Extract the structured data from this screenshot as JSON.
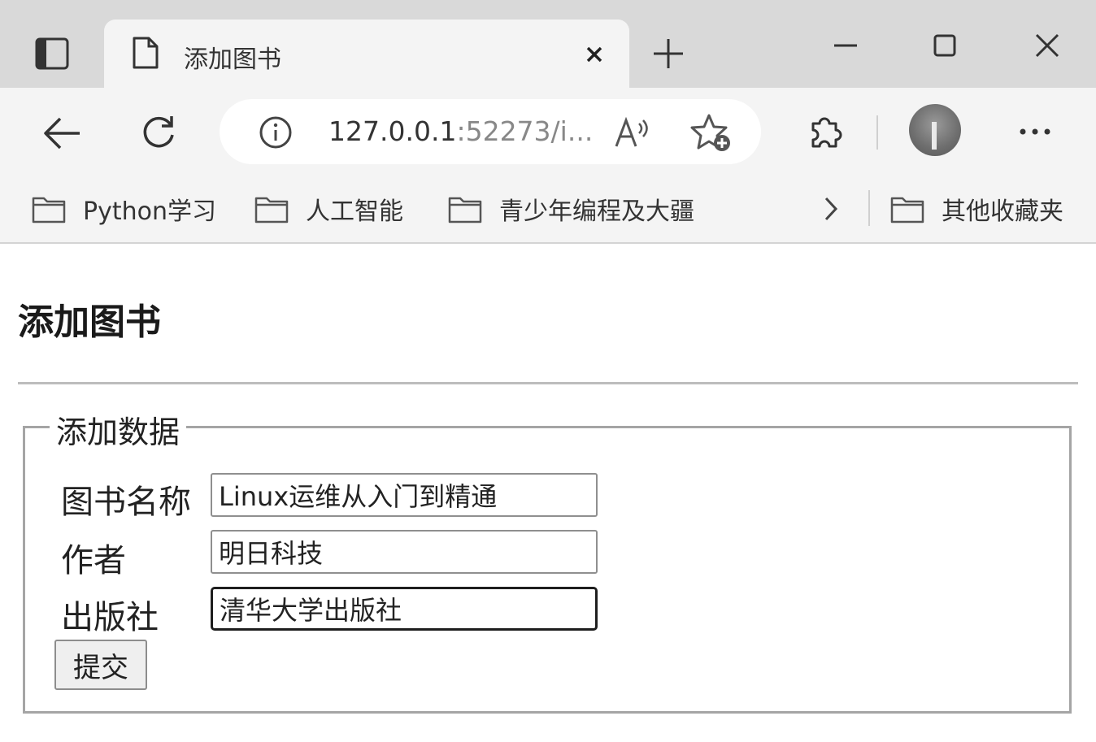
{
  "browser": {
    "tab": {
      "title": "添加图书",
      "close_label": "×"
    },
    "new_tab_label": "+",
    "address_bar": {
      "url_host": "127.0.0.1",
      "url_rest": ":52273/i..."
    },
    "favorites": [
      {
        "label": "Python学习"
      },
      {
        "label": "人工智能"
      },
      {
        "label": "青少年编程及大疆"
      }
    ],
    "other_favorites": {
      "label": "其他收藏夹"
    },
    "more_label": "···"
  },
  "page": {
    "heading": "添加图书",
    "fieldset": {
      "legend": "添加数据",
      "fields": [
        {
          "label": "图书名称",
          "value": "Linux运维从入门到精通"
        },
        {
          "label": "作者",
          "value": "明日科技"
        },
        {
          "label": "出版社",
          "value": "清华大学出版社"
        }
      ],
      "submit_label": "提交"
    }
  }
}
